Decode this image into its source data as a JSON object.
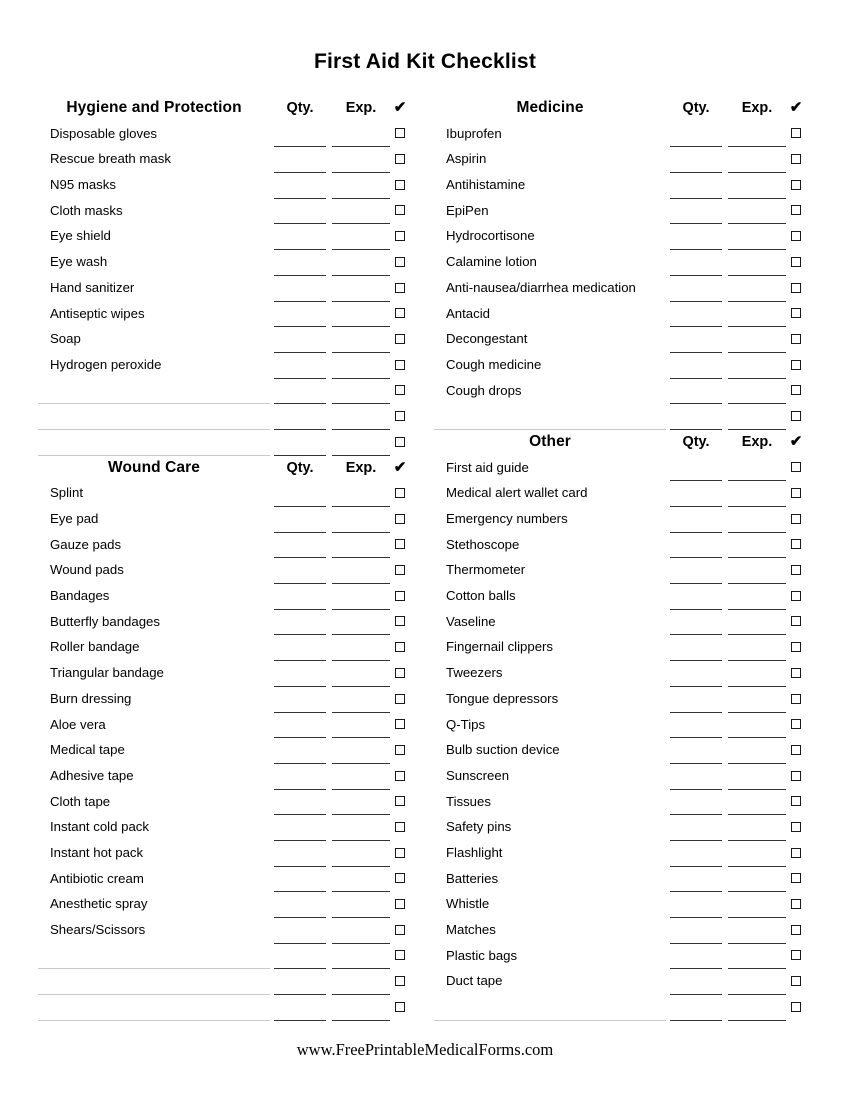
{
  "document": {
    "title": "First Aid Kit Checklist",
    "footer": "www.FreePrintableMedicalForms.com"
  },
  "column_headers": {
    "qty": "Qty.",
    "exp": "Exp.",
    "check": "✔"
  },
  "sections": [
    {
      "id": "hygiene-and-protection",
      "title": "Hygiene and Protection",
      "column": "left",
      "items": [
        "Disposable gloves",
        "Rescue breath mask",
        "N95 masks",
        "Cloth masks",
        "Eye shield",
        "Eye wash",
        "Hand sanitizer",
        "Antiseptic wipes",
        "Soap",
        "Hydrogen peroxide"
      ],
      "blank_rows": 3
    },
    {
      "id": "wound-care",
      "title": "Wound Care",
      "column": "left",
      "items": [
        "Splint",
        "Eye pad",
        "Gauze pads",
        "Wound pads",
        "Bandages",
        "Butterfly bandages",
        "Roller bandage",
        "Triangular bandage",
        "Burn dressing",
        "Aloe vera",
        "Medical tape",
        "Adhesive tape",
        "Cloth tape",
        "Instant cold pack",
        "Instant hot pack",
        "Antibiotic cream",
        "Anesthetic spray",
        "Shears/Scissors"
      ],
      "blank_rows": 3
    },
    {
      "id": "medicine",
      "title": "Medicine",
      "column": "right",
      "items": [
        "Ibuprofen",
        "Aspirin",
        "Antihistamine",
        "EpiPen",
        "Hydrocortisone",
        "Calamine lotion",
        "Anti-nausea/diarrhea medication",
        "Antacid",
        "Decongestant",
        "Cough medicine",
        "Cough drops"
      ],
      "blank_rows": 1
    },
    {
      "id": "other",
      "title": "Other",
      "column": "right",
      "items": [
        "First aid guide",
        "Medical alert wallet card",
        "Emergency numbers",
        "Stethoscope",
        "Thermometer",
        "Cotton balls",
        "Vaseline",
        "Fingernail clippers",
        "Tweezers",
        "Tongue depressors",
        "Q-Tips",
        "Bulb suction device",
        "Sunscreen",
        "Tissues",
        "Safety pins",
        "Flashlight",
        "Batteries",
        "Whistle",
        "Matches",
        "Plastic bags",
        "Duct tape"
      ],
      "blank_rows": 1
    }
  ],
  "colors": {
    "text": "#000000",
    "writein_rule": "#c8c8c8",
    "field_rule": "#333333",
    "checkbox_border": "#1a1a1a"
  }
}
